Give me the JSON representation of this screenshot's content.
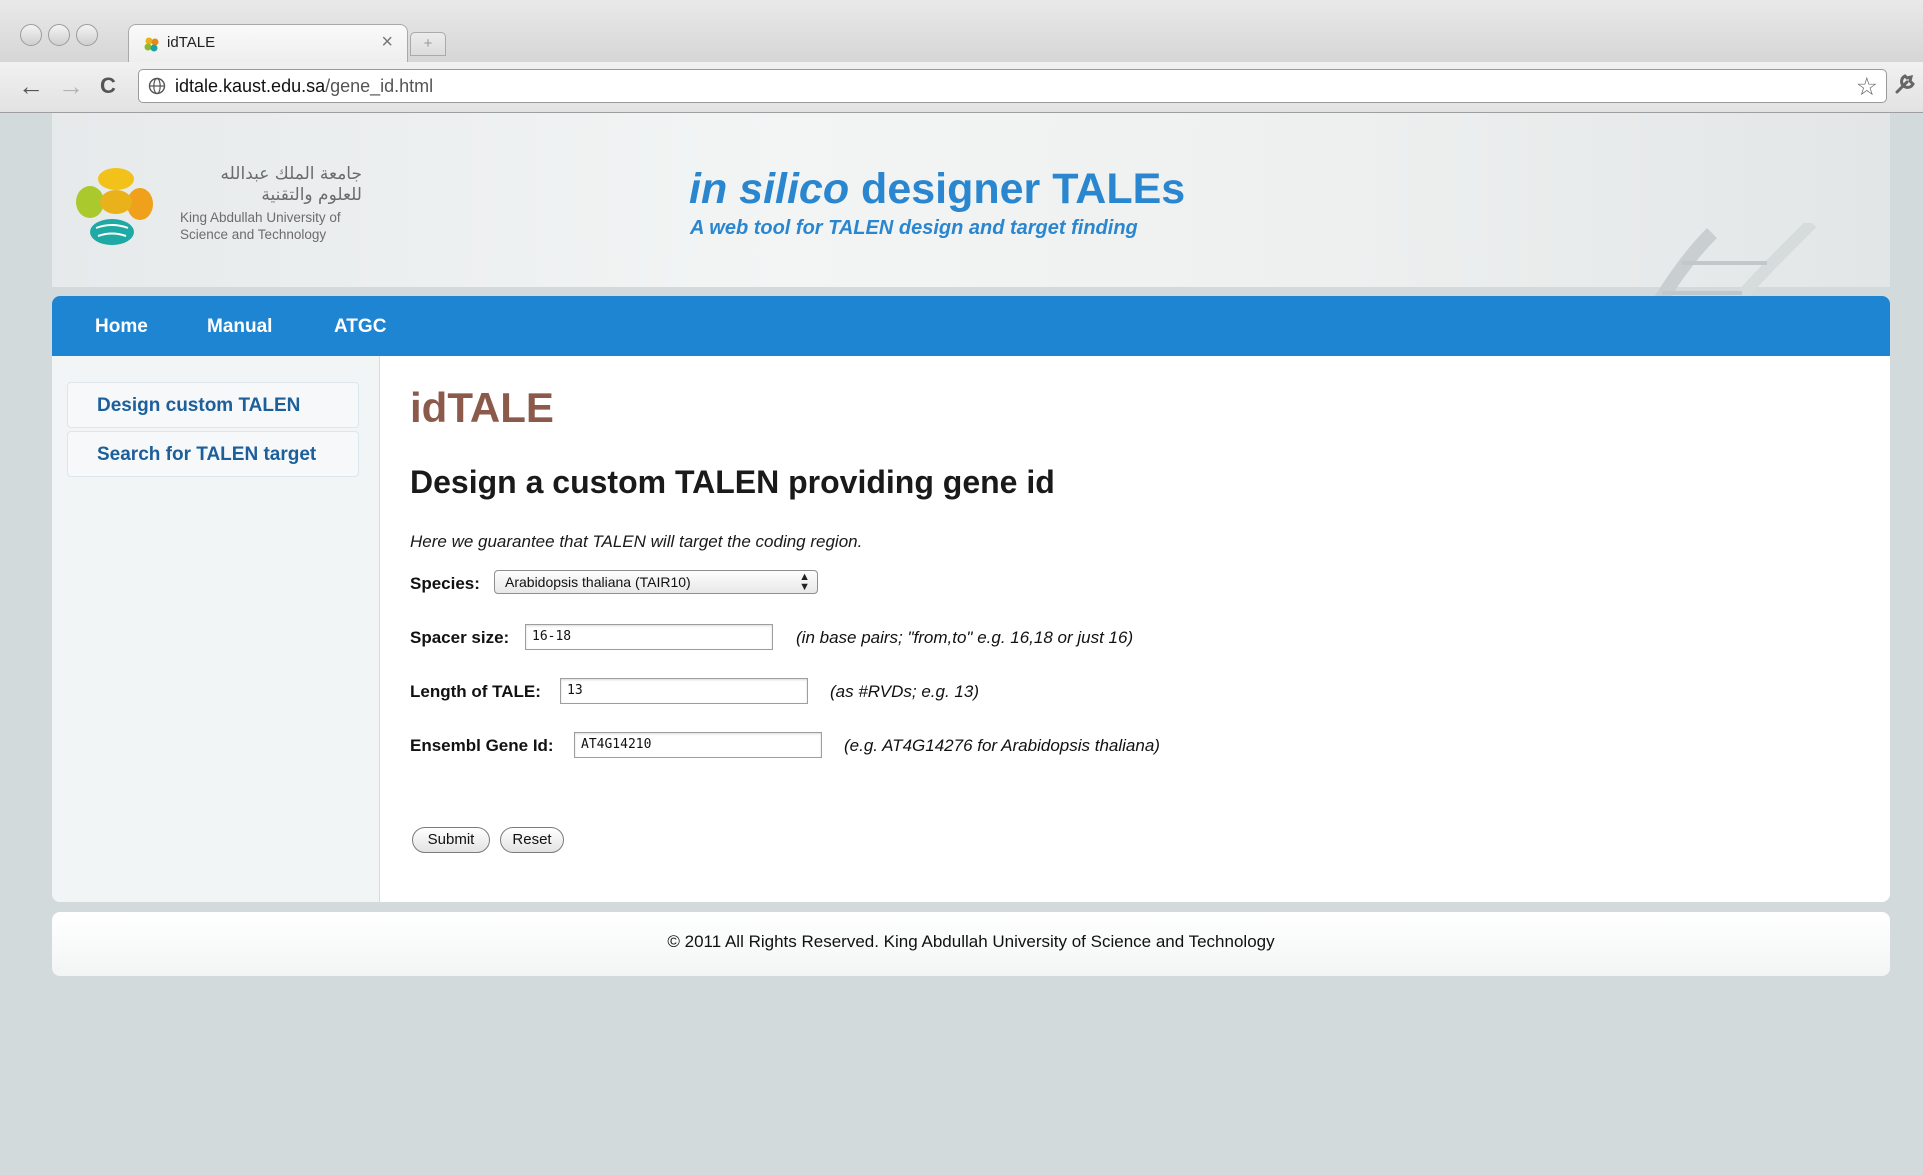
{
  "browser": {
    "tab_title": "idTALE",
    "tab_close": "×",
    "new_tab": "+",
    "url_domain": "idtale.kaust.edu.sa",
    "url_path": "/gene_id.html",
    "back": "←",
    "forward": "→",
    "reload": "C",
    "star": "☆",
    "wrench": "🔧"
  },
  "header": {
    "logo_arabic_line1": "جامعة الملك عبدالله",
    "logo_arabic_line2": "للعلوم والتقنية",
    "logo_en_line1": "King Abdullah University of",
    "logo_en_line2": "Science and Technology",
    "title_italic": "in silico",
    "title_rest": " designer TALEs",
    "subtitle": "A web tool for TALEN design and target finding"
  },
  "nav": {
    "items": [
      "Home",
      "Manual",
      "ATGC"
    ]
  },
  "sidebar": {
    "items": [
      "Design custom TALEN",
      "Search for TALEN target"
    ]
  },
  "main": {
    "app_title": "idTALE",
    "heading": "Design a custom TALEN providing gene id",
    "intro": "Here we guarantee that TALEN will target the coding region.",
    "species_label": "Species:",
    "species_value": "Arabidopsis thaliana (TAIR10)",
    "spacer_label": "Spacer size:",
    "spacer_value": "16-18",
    "spacer_hint": "(in base pairs; \"from,to\" e.g. 16,18 or just 16)",
    "length_label": "Length of TALE:",
    "length_value": "13",
    "length_hint": "(as #RVDs; e.g. 13)",
    "gene_label": "Ensembl Gene Id:",
    "gene_value": "AT4G14210",
    "gene_hint": "(e.g. AT4G14276 for Arabidopsis thaliana)",
    "submit_label": "Submit",
    "reset_label": "Reset"
  },
  "footer": {
    "text": "© 2011 All Rights Reserved. King Abdullah University of Science and Technology"
  }
}
